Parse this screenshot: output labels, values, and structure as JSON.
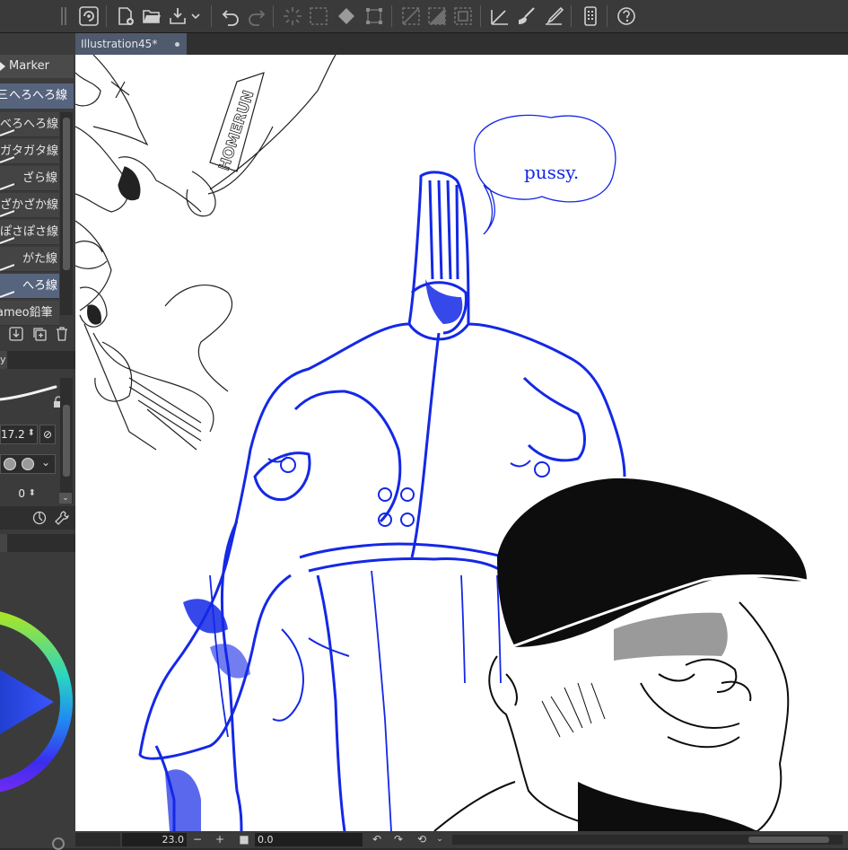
{
  "toolbar": {
    "icons": [
      "app-logo-icon",
      "new-file-icon",
      "open-file-icon",
      "save-icon",
      "dropdown-icon",
      "undo-icon",
      "redo-icon",
      "clear-selection-icon",
      "select-all-icon",
      "fill-icon",
      "transform-icon",
      "hide-selection-icon",
      "invert-selection-icon",
      "selection-border-icon",
      "ruler-icon",
      "brush-icon",
      "pen-icon",
      "smartphone-icon",
      "help-icon"
    ]
  },
  "subtool": {
    "group_label": "Marker",
    "selected_group": "へろへろ線",
    "brushes": [
      {
        "label": "べろへろ線",
        "selected": false
      },
      {
        "label": "ガタガタ線",
        "selected": false
      },
      {
        "label": "ざら線",
        "selected": false
      },
      {
        "label": "ざかざか線",
        "selected": false
      },
      {
        "label": "ぽさぽさ線",
        "selected": false
      },
      {
        "label": "がた線",
        "selected": false
      },
      {
        "label": "へろ線",
        "selected": true
      },
      {
        "label": "ameo鉛筆",
        "selected": false
      }
    ]
  },
  "tool_property": {
    "tab_label": "y",
    "brush_size": "17.2",
    "opacity": "0"
  },
  "color": {
    "tab_label": ""
  },
  "document": {
    "tab_title": "Illustration45*",
    "speech_text": "pussy.",
    "sign_text": "HOMERUN"
  },
  "status": {
    "zoom": "23.0",
    "angle": "0.0",
    "minus": "−",
    "plus": "+"
  },
  "colors": {
    "accent": "#56647e",
    "sketch_blue": "#1428e6",
    "ink": "#111111"
  }
}
